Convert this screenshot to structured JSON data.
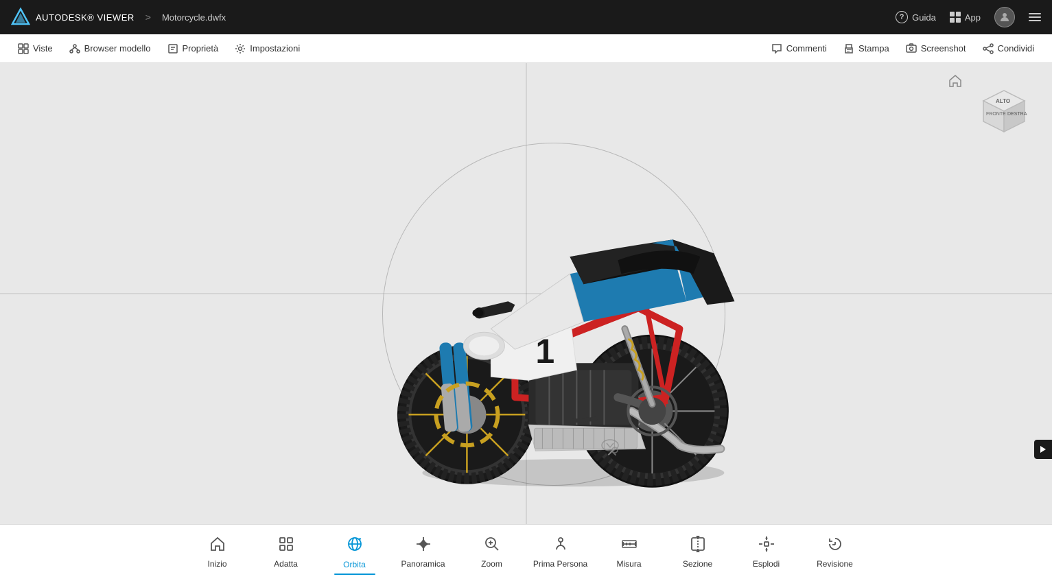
{
  "app": {
    "brand": "AUTODESK® VIEWER",
    "separator": ">",
    "filename": "Motorcycle.dwfx"
  },
  "top_nav": {
    "help_label": "Guida",
    "app_label": "App",
    "hamburger_label": "Menu"
  },
  "toolbar": {
    "viste_label": "Viste",
    "browser_label": "Browser modello",
    "proprieta_label": "Proprietà",
    "impostazioni_label": "Impostazioni",
    "commenti_label": "Commenti",
    "stampa_label": "Stampa",
    "screenshot_label": "Screenshot",
    "condividi_label": "Condividi"
  },
  "bottom_tools": [
    {
      "id": "inizio",
      "label": "Inizio",
      "active": false
    },
    {
      "id": "adatta",
      "label": "Adatta",
      "active": false
    },
    {
      "id": "orbita",
      "label": "Orbita",
      "active": true
    },
    {
      "id": "panoramica",
      "label": "Panoramica",
      "active": false
    },
    {
      "id": "zoom",
      "label": "Zoom",
      "active": false
    },
    {
      "id": "prima-persona",
      "label": "Prima Persona",
      "active": false
    },
    {
      "id": "misura",
      "label": "Misura",
      "active": false
    },
    {
      "id": "sezione",
      "label": "Sezione",
      "active": false
    },
    {
      "id": "esplodi",
      "label": "Esplodi",
      "active": false
    },
    {
      "id": "revisione",
      "label": "Revisione",
      "active": false
    }
  ],
  "viewcube": {
    "alto": "ALTO",
    "fronte": "FRONTE",
    "destra": "DESTRA"
  },
  "feedback": "◀"
}
